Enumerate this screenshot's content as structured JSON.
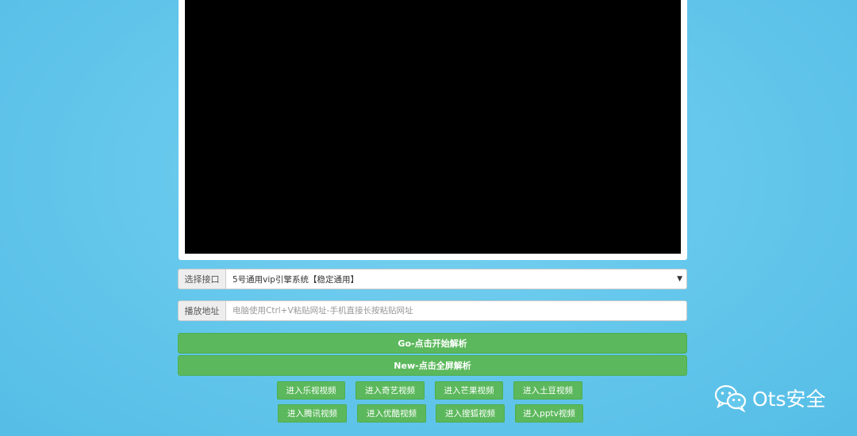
{
  "interface": {
    "label": "选择接口",
    "selected": "5号通用vip引擎系统【稳定通用】",
    "caret_icon": "▼"
  },
  "address": {
    "label": "播放地址",
    "placeholder": "电脑使用Ctrl+V粘贴网址-手机直接长按粘贴网址"
  },
  "buttons": {
    "go": "Go-点击开始解析",
    "fullscreen": "New-点击全屏解析"
  },
  "sites_row1": [
    "进入乐视视频",
    "进入奇艺视频",
    "进入芒果视频",
    "进入土豆视频"
  ],
  "sites_row2": [
    "进入腾讯视频",
    "进入优酷视频",
    "进入搜狐视频",
    "进入pptv视频"
  ],
  "watermark": {
    "text": "Ots安全",
    "icon": "wechat-icon"
  },
  "colors": {
    "background": "#66c8ec",
    "button_green": "#5cb85c"
  }
}
